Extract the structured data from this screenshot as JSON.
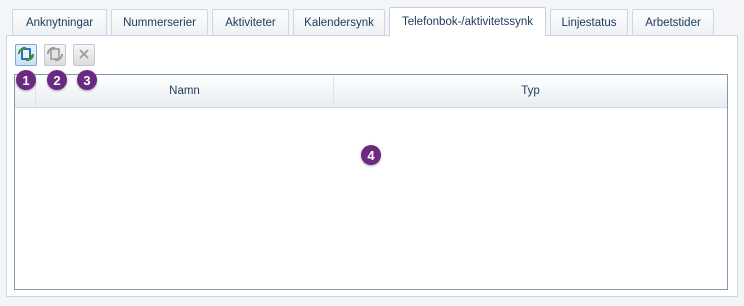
{
  "tabs": [
    {
      "label": "Anknytningar"
    },
    {
      "label": "Nummerserier"
    },
    {
      "label": "Aktiviteter"
    },
    {
      "label": "Kalendersynk"
    },
    {
      "label": "Telefonbok-/aktivitetssynk",
      "active": true
    },
    {
      "label": "Linjestatus"
    },
    {
      "label": "Arbetstider"
    }
  ],
  "toolbar": {
    "buttons": [
      {
        "icon": "sync-add-icon",
        "enabled": true
      },
      {
        "icon": "sync-icon",
        "enabled": false
      },
      {
        "icon": "close-icon",
        "enabled": false
      }
    ]
  },
  "grid": {
    "columns": [
      "Namn",
      "Typ"
    ],
    "rows": []
  },
  "callouts": [
    "1",
    "2",
    "3",
    "4"
  ],
  "colors": {
    "callout": "#6b2a7f",
    "tab_text": "#1e3a5a",
    "grid_border": "#7f98b3"
  }
}
